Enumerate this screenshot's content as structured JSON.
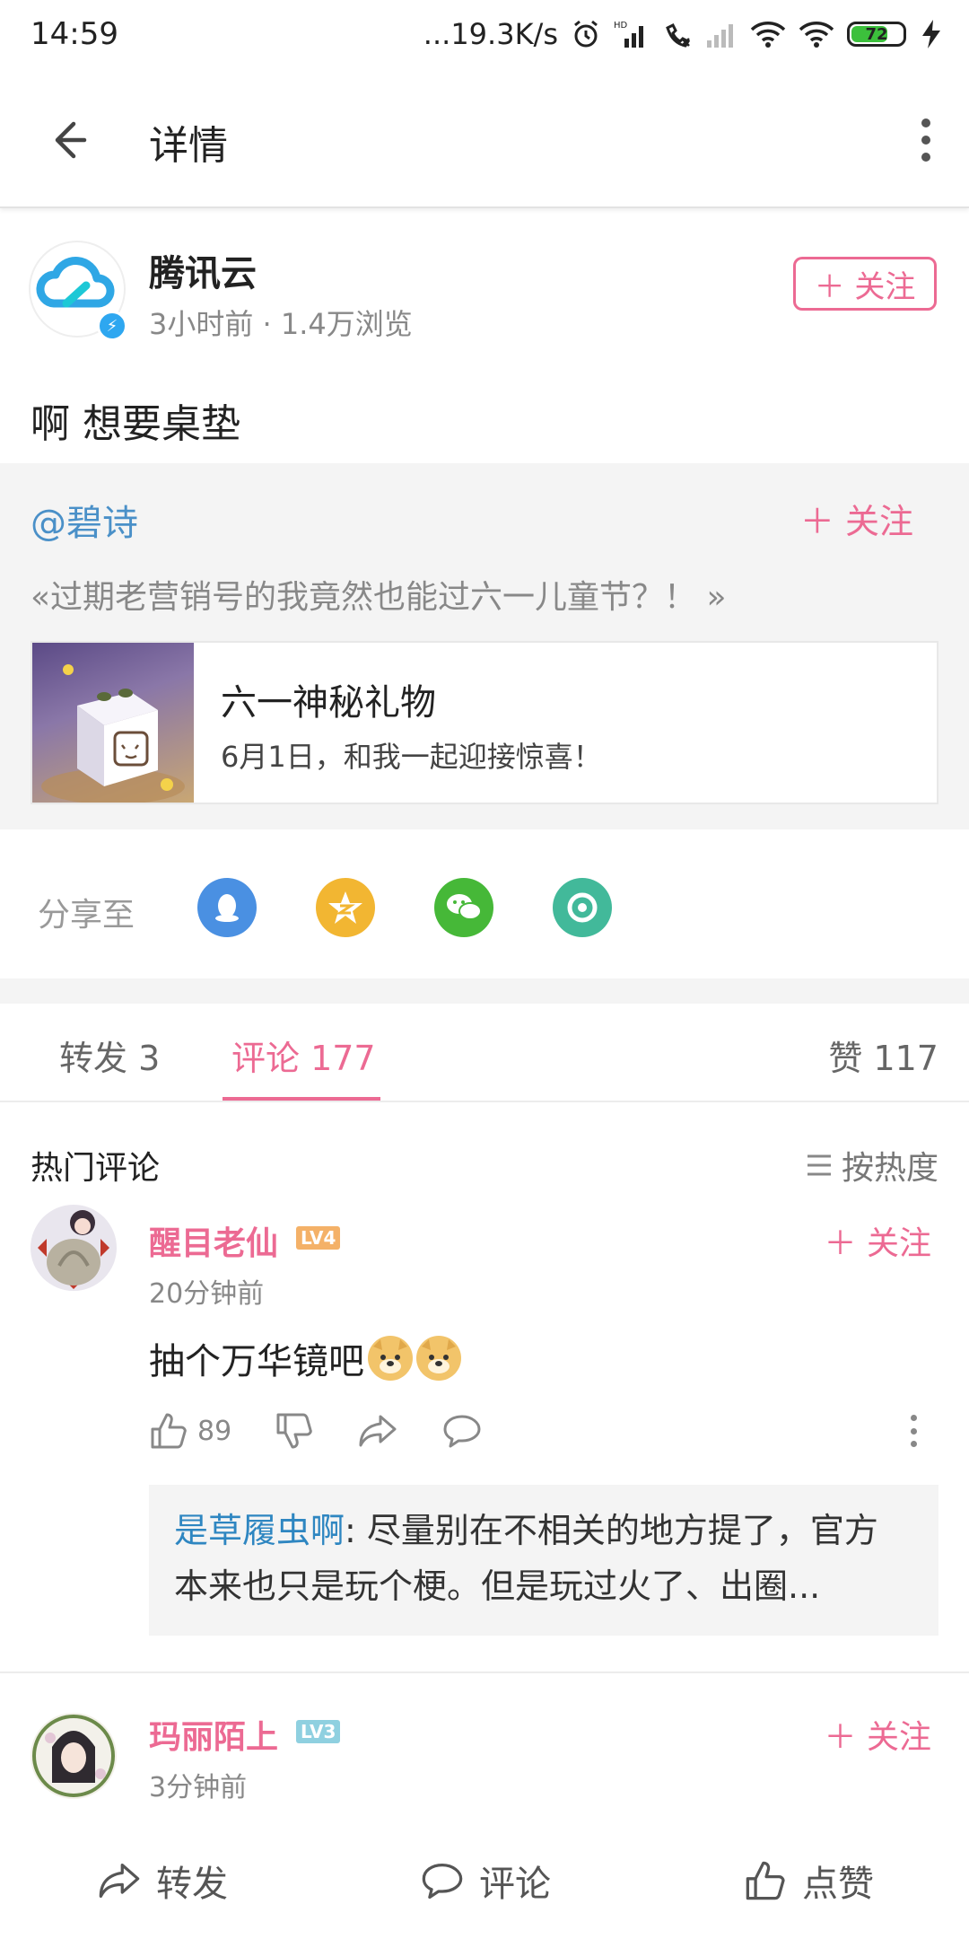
{
  "status_bar": {
    "time": "14:59",
    "network_speed": "...19.3K/s",
    "battery_level": "72",
    "icons": [
      "alarm-icon",
      "hd-signal-icon",
      "call-missed-icon",
      "signal-icon",
      "wifi-icon",
      "wifi-2-icon",
      "battery-icon",
      "charging-icon"
    ]
  },
  "header": {
    "title": "详情",
    "back_icon": "arrow-left-icon",
    "more_icon": "more-vertical-icon"
  },
  "post": {
    "author": "腾讯云",
    "meta": "3小时前 · 1.4万浏览",
    "follow_label": "＋ 关注",
    "text": "啊  想要桌垫"
  },
  "repost": {
    "user": "@碧诗",
    "follow_label": "＋ 关注",
    "text": "«过期老营销号的我竟然也能过六一儿童节？！ »",
    "card": {
      "title": "六一神秘礼物",
      "subtitle": "6月1日，和我一起迎接惊喜！"
    }
  },
  "share": {
    "label": "分享至",
    "targets": [
      {
        "name": "qq-icon",
        "color": "#4a90e2"
      },
      {
        "name": "qzone-icon",
        "color": "#f2b632"
      },
      {
        "name": "wechat-icon",
        "color": "#46b838"
      },
      {
        "name": "moments-icon",
        "color": "#42b99a"
      }
    ]
  },
  "tabs": {
    "repost": "转发 3",
    "comments": "评论 177",
    "likes": "赞 117"
  },
  "comments_section": {
    "title": "热门评论",
    "sort_label": "按热度"
  },
  "comments": [
    {
      "name": "醒目老仙",
      "level": "LV4",
      "time": "20分钟前",
      "follow_label": "＋ 关注",
      "text": "抽个万华镜吧",
      "like_count": "89",
      "reply": {
        "user": "是草履虫啊",
        "text": ": 尽量别在不相关的地方提了，官方本来也只是玩个梗。但是玩过火了、出圈..."
      }
    },
    {
      "name": "玛丽陌上",
      "level": "LV3",
      "time": "3分钟前",
      "follow_label": "＋ 关注"
    }
  ],
  "bottom_bar": {
    "repost": "转发",
    "comment": "评论",
    "like": "点赞"
  },
  "colors": {
    "accent": "#ec6a93",
    "link": "#4a90c8",
    "muted": "#888888"
  }
}
